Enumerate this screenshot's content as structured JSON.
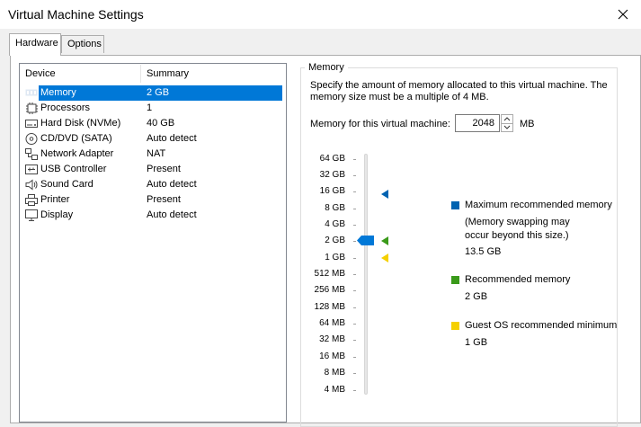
{
  "window": {
    "title": "Virtual Machine Settings"
  },
  "tabs": [
    {
      "label": "Hardware",
      "active": true
    },
    {
      "label": "Options",
      "active": false
    }
  ],
  "device_list": {
    "headers": {
      "device": "Device",
      "summary": "Summary"
    },
    "items": [
      {
        "name": "Memory",
        "summary": "2 GB",
        "icon": "memory-icon",
        "selected": true
      },
      {
        "name": "Processors",
        "summary": "1",
        "icon": "processor-icon"
      },
      {
        "name": "Hard Disk (NVMe)",
        "summary": "40 GB",
        "icon": "hard-disk-icon"
      },
      {
        "name": "CD/DVD (SATA)",
        "summary": "Auto detect",
        "icon": "cd-dvd-icon"
      },
      {
        "name": "Network Adapter",
        "summary": "NAT",
        "icon": "network-icon"
      },
      {
        "name": "USB Controller",
        "summary": "Present",
        "icon": "usb-icon"
      },
      {
        "name": "Sound Card",
        "summary": "Auto detect",
        "icon": "speaker-icon"
      },
      {
        "name": "Printer",
        "summary": "Present",
        "icon": "printer-icon"
      },
      {
        "name": "Display",
        "summary": "Auto detect",
        "icon": "display-icon"
      }
    ]
  },
  "memory_panel": {
    "group_title": "Memory",
    "description": "Specify the amount of memory allocated to this virtual machine. The memory size must be a multiple of 4 MB.",
    "field_label": "Memory for this virtual machine:",
    "value": "2048",
    "unit": "MB",
    "scale_labels": [
      "64 GB",
      "32 GB",
      "16 GB",
      "8 GB",
      "4 GB",
      "2 GB",
      "1 GB",
      "512 MB",
      "256 MB",
      "128 MB",
      "64 MB",
      "32 MB",
      "16 MB",
      "8 MB",
      "4 MB"
    ],
    "slider_value": "2 GB",
    "legend": {
      "max": {
        "label": "Maximum recommended memory",
        "note": "(Memory swapping may occur beyond this size.)",
        "value": "13.5 GB",
        "color": "#0063b1"
      },
      "recommended": {
        "label": "Recommended memory",
        "value": "2 GB",
        "color": "#3a9a1a"
      },
      "minimum": {
        "label": "Guest OS recommended minimum",
        "value": "1 GB",
        "color": "#f5d000"
      }
    }
  },
  "colors": {
    "selection": "#0078d7",
    "slider_thumb": "#0078d7"
  }
}
